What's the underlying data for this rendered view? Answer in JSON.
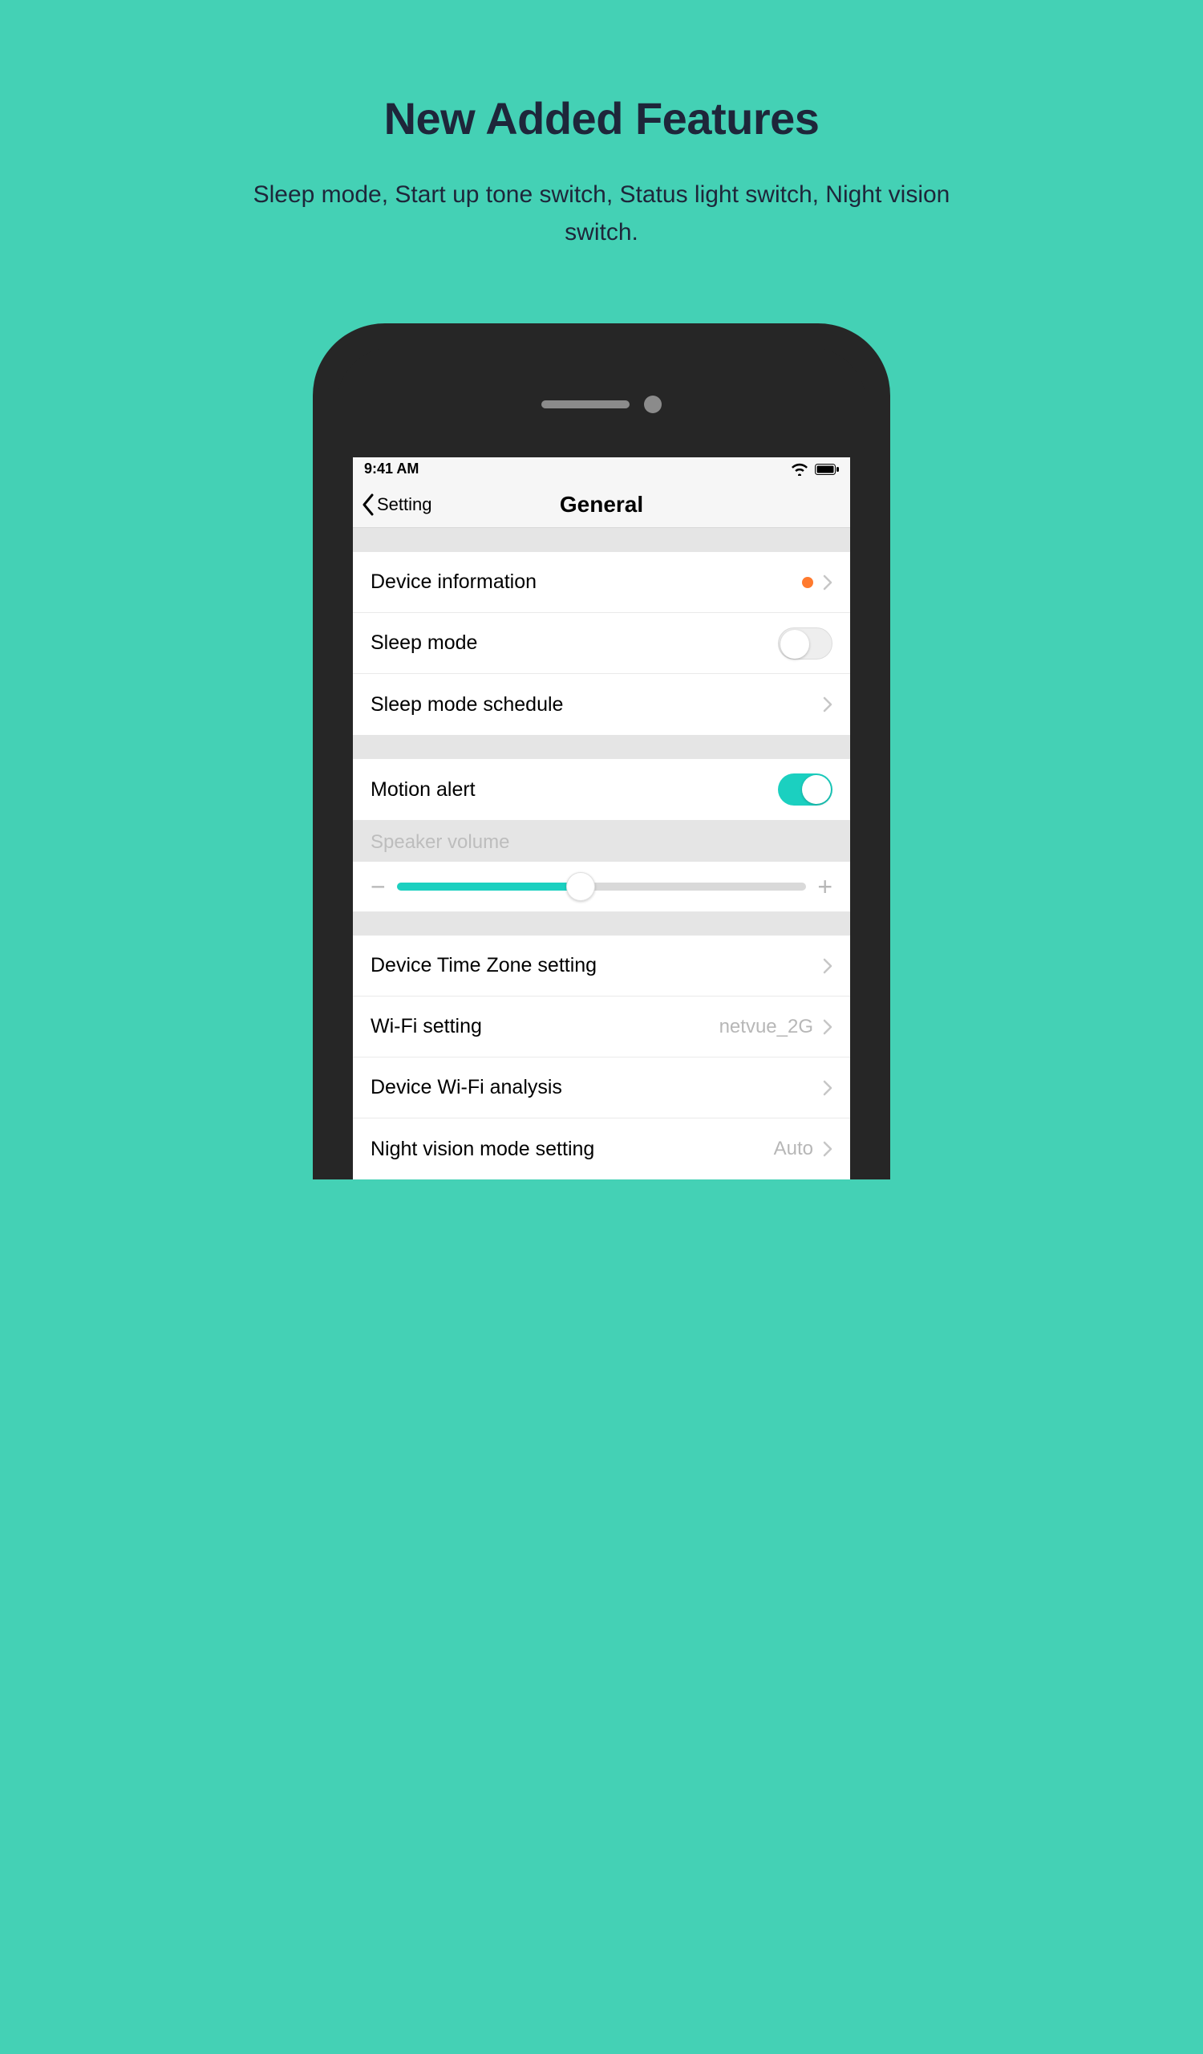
{
  "marketing": {
    "headline": "New Added Features",
    "subhead": "Sleep mode, Start up tone switch, Status light switch, Night vision switch."
  },
  "status": {
    "time": "9:41 AM"
  },
  "nav": {
    "back_label": "Setting",
    "title": "General"
  },
  "sections": {
    "group1": {
      "device_info": "Device information",
      "sleep_mode": "Sleep mode",
      "sleep_schedule": "Sleep mode schedule"
    },
    "group2": {
      "motion_alert": "Motion alert"
    },
    "slider": {
      "label": "Speaker volume",
      "percent": 45
    },
    "group3": {
      "timezone": "Device Time Zone setting",
      "wifi": "Wi-Fi setting",
      "wifi_value": "netvue_2G",
      "wifi_analysis": "Device Wi-Fi analysis",
      "night_vision": "Night vision mode setting",
      "night_vision_value": "Auto"
    }
  },
  "toggles": {
    "sleep_mode": false,
    "motion_alert": true
  }
}
